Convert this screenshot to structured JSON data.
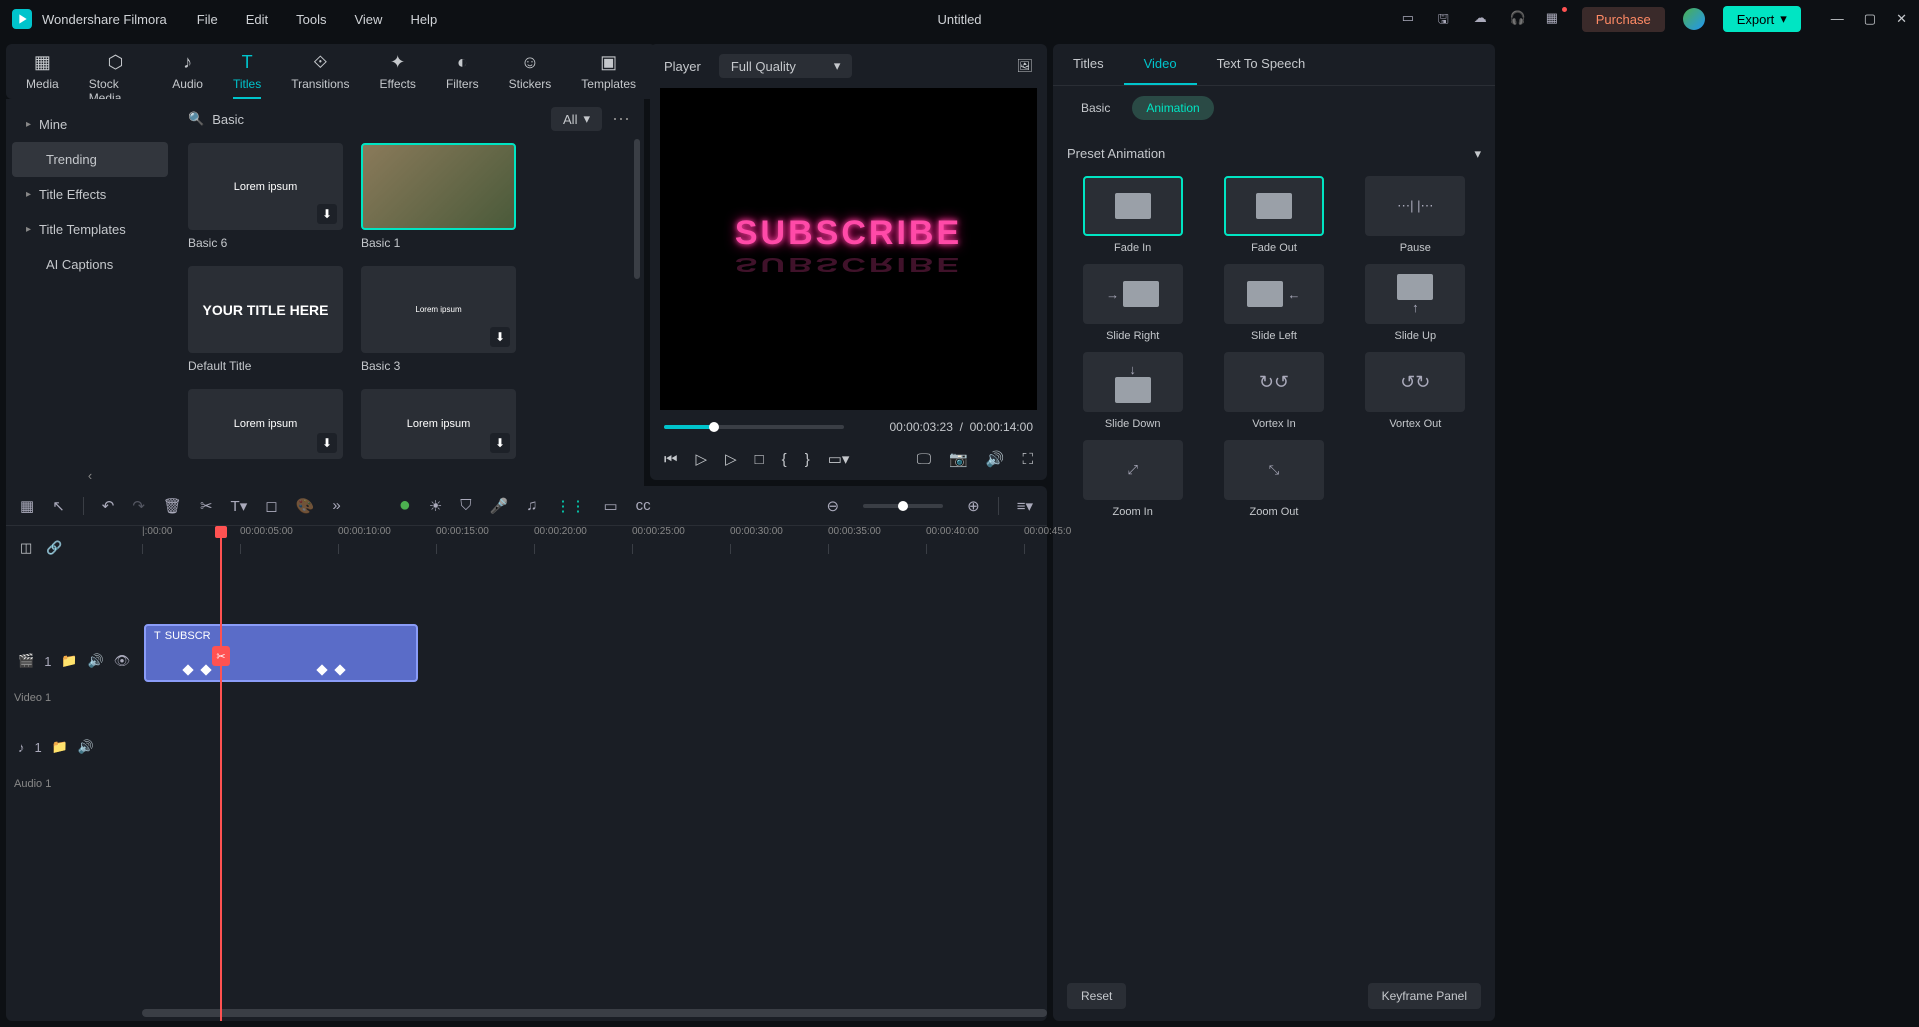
{
  "app": {
    "name": "Wondershare Filmora",
    "project_title": "Untitled"
  },
  "menu": {
    "file": "File",
    "edit": "Edit",
    "tools": "Tools",
    "view": "View",
    "help": "Help"
  },
  "titlebar": {
    "purchase": "Purchase",
    "export": "Export"
  },
  "toolbar_tabs": {
    "media": "Media",
    "stock": "Stock Media",
    "audio": "Audio",
    "titles": "Titles",
    "transitions": "Transitions",
    "effects": "Effects",
    "filters": "Filters",
    "stickers": "Stickers",
    "templates": "Templates"
  },
  "lib_sidebar": {
    "mine": "Mine",
    "trending": "Trending",
    "title_effects": "Title Effects",
    "title_templates": "Title Templates",
    "ai_captions": "AI Captions"
  },
  "lib": {
    "search_placeholder": "Basic",
    "filter_all": "All",
    "items": [
      {
        "thumb": "Lorem ipsum",
        "label": "Basic 6"
      },
      {
        "thumb": "",
        "label": "Basic 1"
      },
      {
        "thumb": "YOUR TITLE HERE",
        "label": "Default Title"
      },
      {
        "thumb": "Lorem ipsum",
        "label": "Basic 3"
      },
      {
        "thumb": "Lorem ipsum",
        "label": ""
      },
      {
        "thumb": "Lorem ipsum",
        "label": ""
      }
    ]
  },
  "player": {
    "label": "Player",
    "quality": "Full Quality",
    "preview_text": "SUBSCRIBE",
    "time_current": "00:00:03:23",
    "time_sep": "/",
    "time_total": "00:00:14:00"
  },
  "inspector": {
    "tabs": {
      "titles": "Titles",
      "video": "Video",
      "tts": "Text To Speech"
    },
    "subtabs": {
      "basic": "Basic",
      "animation": "Animation"
    },
    "section": "Preset Animation",
    "anims": [
      "Fade In",
      "Fade Out",
      "Pause",
      "Slide Right",
      "Slide Left",
      "Slide Up",
      "Slide Down",
      "Vortex In",
      "Vortex Out",
      "Zoom In",
      "Zoom Out"
    ],
    "reset": "Reset",
    "keyframe_panel": "Keyframe Panel"
  },
  "timeline": {
    "ruler": [
      "|:00:00",
      "00:00:05:00",
      "00:00:10:00",
      "00:00:15:00",
      "00:00:20:00",
      "00:00:25:00",
      "00:00:30:00",
      "00:00:35:00",
      "00:00:40:00",
      "00:00:45:0"
    ],
    "clip_name": "SUBSCR",
    "tracks": {
      "video1": "Video 1",
      "audio1": "Audio 1",
      "v1_badge": "1",
      "a1_badge": "1"
    }
  }
}
